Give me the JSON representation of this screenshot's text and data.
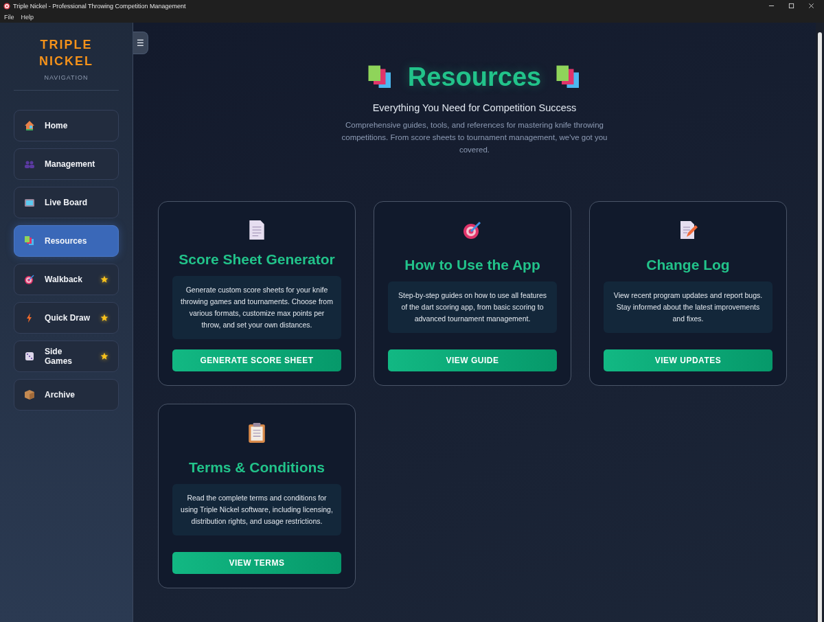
{
  "window": {
    "title": "Triple Nickel - Professional Throwing Competition Management"
  },
  "menu": [
    "File",
    "Help"
  ],
  "sidebar": {
    "brand": [
      "TRIPLE",
      "NICKEL"
    ],
    "subtitle": "NAVIGATION",
    "toggle": "☰",
    "items": [
      {
        "label": "Home",
        "kind": "house",
        "selected": false,
        "starred": false
      },
      {
        "label": "Management",
        "kind": "people",
        "selected": false,
        "starred": false
      },
      {
        "label": "Live Board",
        "kind": "tv",
        "selected": false,
        "starred": false
      },
      {
        "label": "Resources",
        "kind": "books",
        "selected": true,
        "starred": false
      },
      {
        "label": "Walkback",
        "kind": "target",
        "selected": false,
        "starred": true
      },
      {
        "label": "Quick Draw",
        "kind": "bolt",
        "selected": false,
        "starred": true
      },
      {
        "label": "Side Games",
        "kind": "dice",
        "selected": false,
        "starred": true
      },
      {
        "label": "Archive",
        "kind": "box",
        "selected": false,
        "starred": false
      }
    ]
  },
  "header": {
    "title": "Resources",
    "subtitle": "Everything You Need for Competition Success",
    "description": "Comprehensive guides, tools, and references for mastering knife throwing competitions. From score sheets to tournament management, we've got you covered."
  },
  "cards": [
    {
      "kind": "document",
      "title": "Score Sheet Generator",
      "description": "Generate custom score sheets for your knife throwing games and tournaments. Choose from various formats, customize max points per throw, and set your own distances.",
      "button": "GENERATE SCORE SHEET"
    },
    {
      "kind": "target",
      "title": "How to Use the App",
      "description": "Step-by-step guides on how to use all features of the dart scoring app, from basic scoring to advanced tournament management.",
      "button": "VIEW GUIDE"
    },
    {
      "kind": "memo",
      "title": "Change Log",
      "description": "View recent program updates and report bugs. Stay informed about the latest improvements and fixes.",
      "button": "VIEW UPDATES"
    },
    {
      "kind": "clipboard",
      "title": "Terms & Conditions",
      "description": "Read the complete terms and conditions for using Triple Nickel software, including licensing, distribution rights, and usage restrictions.",
      "button": "VIEW TERMS"
    }
  ]
}
